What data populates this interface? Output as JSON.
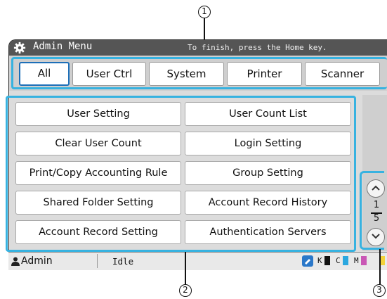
{
  "callouts": {
    "c1": "1",
    "c2": "2",
    "c3": "3"
  },
  "titlebar": {
    "title": "Admin Menu",
    "hint": "To finish, press the Home key.",
    "icon": "gear-icon"
  },
  "tabs": [
    {
      "label": "All",
      "active": true
    },
    {
      "label": "User Ctrl",
      "active": false
    },
    {
      "label": "System",
      "active": false
    },
    {
      "label": "Printer",
      "active": false
    },
    {
      "label": "Scanner",
      "active": false
    }
  ],
  "menu": {
    "left": [
      "User Setting",
      "Clear User Count",
      "Print/Copy Accounting Rule",
      "Shared Folder Setting",
      "Account Record Setting"
    ],
    "right": [
      "User Count List",
      "Login Setting",
      "Group Setting",
      "Account Record History",
      "Authentication Servers"
    ]
  },
  "pager": {
    "current": "1",
    "total": "5",
    "up_icon": "chevron-up-icon",
    "down_icon": "chevron-down-icon"
  },
  "status": {
    "user": "Admin",
    "state": "Idle",
    "inks": [
      {
        "label": "K",
        "color": "#111111"
      },
      {
        "label": "C",
        "color": "#2aa7df"
      },
      {
        "label": "M",
        "color": "#c957b5"
      },
      {
        "label": "",
        "color": "#f3d23a"
      }
    ]
  },
  "colors": {
    "accent": "#37b2e0",
    "active_tab_border": "#1d6fb8"
  }
}
